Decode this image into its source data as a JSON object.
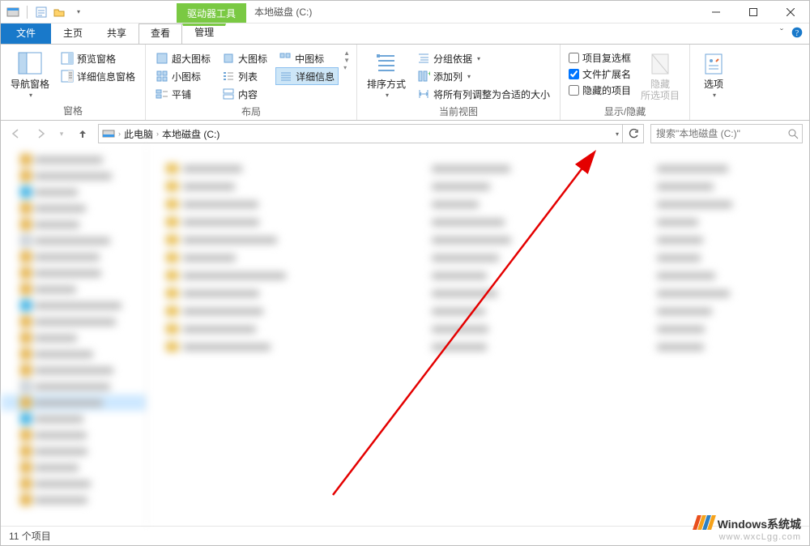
{
  "title_context_tab": "驱动器工具",
  "window_title": "本地磁盘 (C:)",
  "qat_chevron": "▾",
  "ribbon_tabs": {
    "file": "文件",
    "home": "主页",
    "share": "共享",
    "view": "查看",
    "manage": "管理"
  },
  "ribbon": {
    "panes_group": "窗格",
    "nav_pane": "导航窗格",
    "preview_pane": "预览窗格",
    "details_pane": "详细信息窗格",
    "layout_group": "布局",
    "extra_large": "超大图标",
    "large": "大图标",
    "medium": "中图标",
    "small": "小图标",
    "list": "列表",
    "details": "详细信息",
    "tiles": "平铺",
    "content": "内容",
    "current_view_group": "当前视图",
    "sort_by": "排序方式",
    "group_by": "分组依据",
    "add_columns": "添加列",
    "size_all": "将所有列调整为合适的大小",
    "show_hide_group": "显示/隐藏",
    "item_checkboxes": "项目复选框",
    "file_ext": "文件扩展名",
    "hidden_items": "隐藏的项目",
    "hide_selected": "隐藏\n所选项目",
    "options": "选项"
  },
  "address": {
    "this_pc": "此电脑",
    "drive": "本地磁盘 (C:)"
  },
  "search_placeholder": "搜索\"本地磁盘 (C:)\"",
  "status_text": "11 个项目",
  "watermark": {
    "line1": "Windows系统城",
    "line2": "www.wxcLgg.com"
  },
  "tree_dummy": [
    "",
    "",
    "",
    "",
    "",
    "",
    "",
    "",
    "",
    "",
    "",
    "",
    "",
    "",
    "",
    "",
    "",
    "",
    "",
    "",
    "",
    ""
  ],
  "list_col1": [
    "",
    "",
    "",
    "",
    "",
    "",
    "",
    "",
    "",
    "",
    ""
  ],
  "list_col2": [
    "",
    "",
    "",
    "",
    "",
    "",
    "",
    "",
    "",
    "",
    ""
  ],
  "list_col3": [
    "",
    "",
    "",
    "",
    "",
    "",
    "",
    "",
    "",
    "",
    ""
  ]
}
